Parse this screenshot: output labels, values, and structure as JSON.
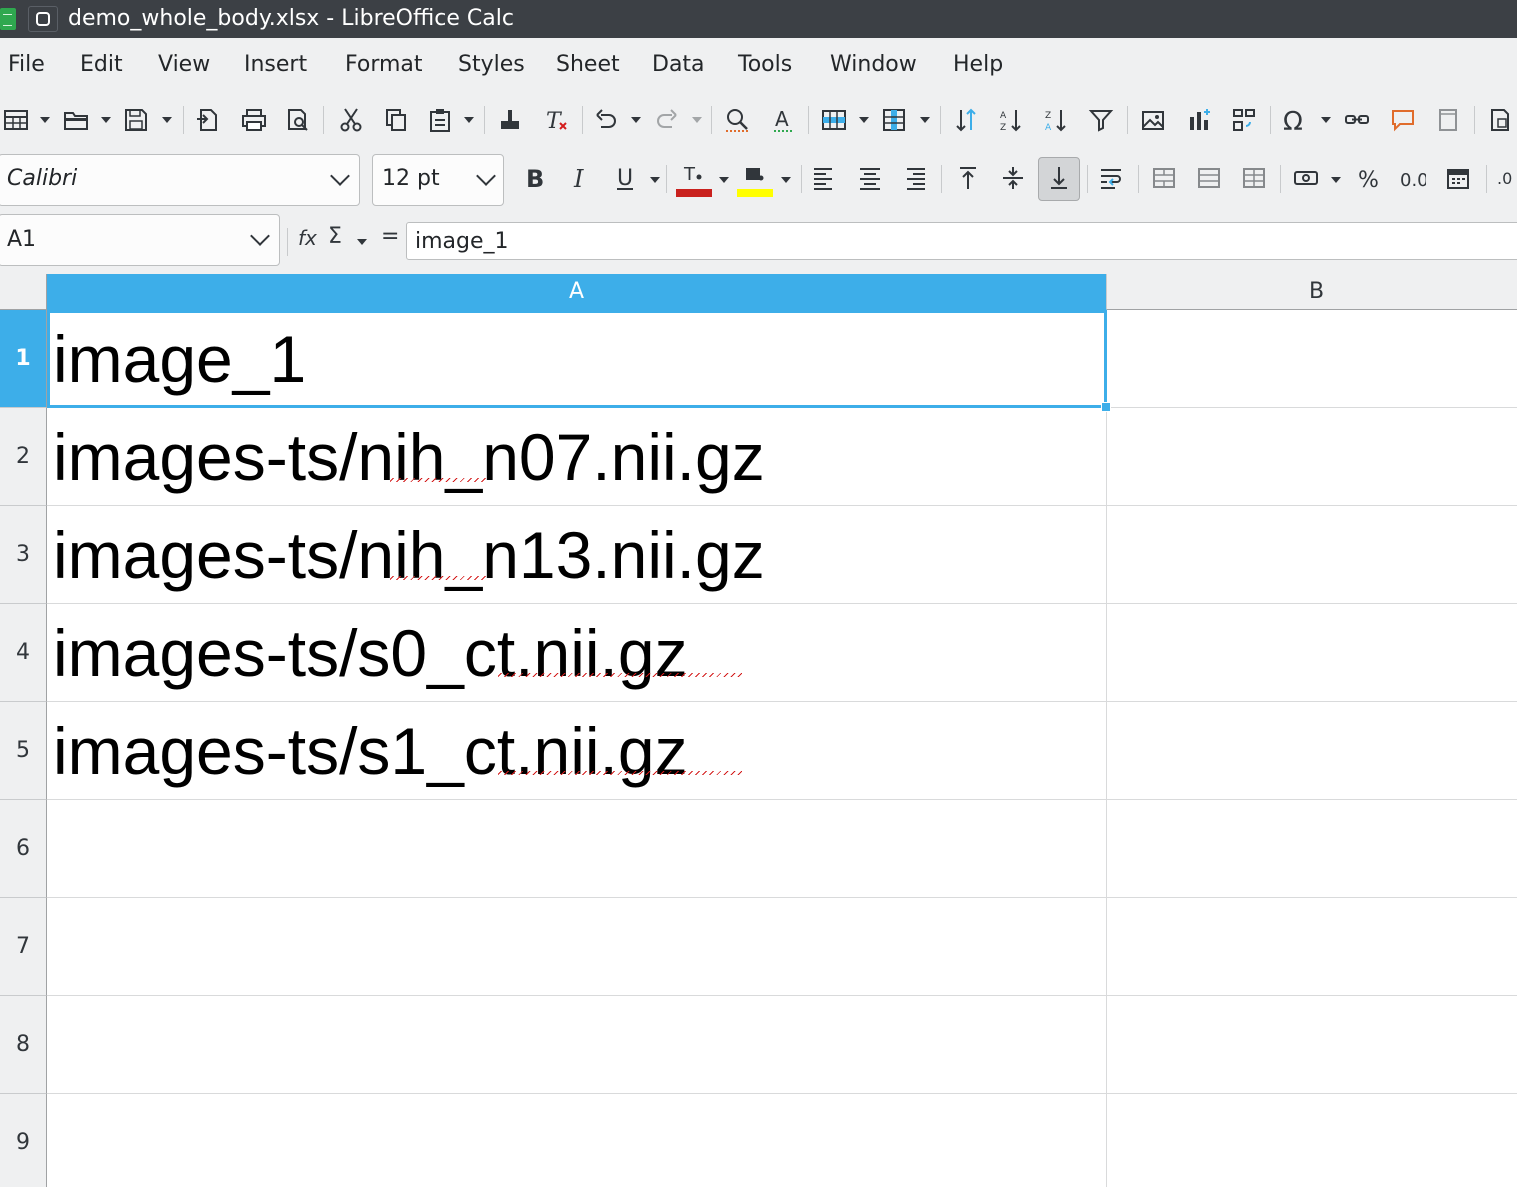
{
  "window": {
    "title": "demo_whole_body.xlsx - LibreOffice Calc"
  },
  "menu": {
    "items": [
      "File",
      "Edit",
      "View",
      "Insert",
      "Format",
      "Styles",
      "Sheet",
      "Data",
      "Tools",
      "Window",
      "Help"
    ]
  },
  "toolbar": {
    "icons": [
      "table-icon",
      "open-icon",
      "save-icon",
      "export-pdf-icon",
      "print-icon",
      "print-preview-icon",
      "cut-icon",
      "copy-icon",
      "paste-icon",
      "clone-formatting-icon",
      "clear-formatting-icon",
      "undo-icon",
      "redo-icon",
      "find-replace-icon",
      "spelling-icon",
      "row-icon",
      "column-icon",
      "sort-icon",
      "sort-ascending-icon",
      "sort-descending-icon",
      "autofilter-icon",
      "insert-image-icon",
      "insert-chart-icon",
      "pivot-table-icon",
      "special-character-icon",
      "hyperlink-icon",
      "comment-icon",
      "headers-footers-icon",
      "define-print-area-icon"
    ]
  },
  "format_bar": {
    "font_name": "Calibri",
    "font_size": "12 pt",
    "font_color": "#c9211e",
    "highlight_color": "#ffff00",
    "icons": [
      "bold-icon",
      "italic-icon",
      "underline-icon",
      "font-color-icon",
      "highlight-color-icon",
      "align-left-icon",
      "align-center-icon",
      "align-right-icon",
      "align-top-icon",
      "align-middle-icon",
      "align-bottom-icon",
      "wrap-text-icon",
      "merge-cells-icon",
      "merge-center-icon",
      "unmerge-icon",
      "currency-icon",
      "percent-icon",
      "number-format-icon",
      "date-format-icon"
    ],
    "bottom_align_active": true
  },
  "formula_bar": {
    "cell_ref": "A1",
    "fx_label": "fx",
    "sum_label": "Σ",
    "equals_label": "=",
    "content": "image_1"
  },
  "sheet": {
    "columns": [
      "A",
      "B"
    ],
    "active_column": "A",
    "active_row": "1",
    "rows": [
      {
        "num": "1",
        "A": "image_1",
        "B": ""
      },
      {
        "num": "2",
        "A": "images-ts/nih_n07.nii.gz",
        "B": ""
      },
      {
        "num": "3",
        "A": "images-ts/nih_n13.nii.gz",
        "B": ""
      },
      {
        "num": "4",
        "A": "images-ts/s0_ct.nii.gz",
        "B": ""
      },
      {
        "num": "5",
        "A": "images-ts/s1_ct.nii.gz",
        "B": ""
      },
      {
        "num": "6",
        "A": "",
        "B": ""
      },
      {
        "num": "7",
        "A": "",
        "B": ""
      },
      {
        "num": "8",
        "A": "",
        "B": ""
      },
      {
        "num": "9",
        "A": "",
        "B": ""
      }
    ]
  },
  "colors": {
    "accent": "#3daee9",
    "titlebar": "#3c4045",
    "chrome": "#eff0f1",
    "spellcheck": "#d41c1c"
  }
}
